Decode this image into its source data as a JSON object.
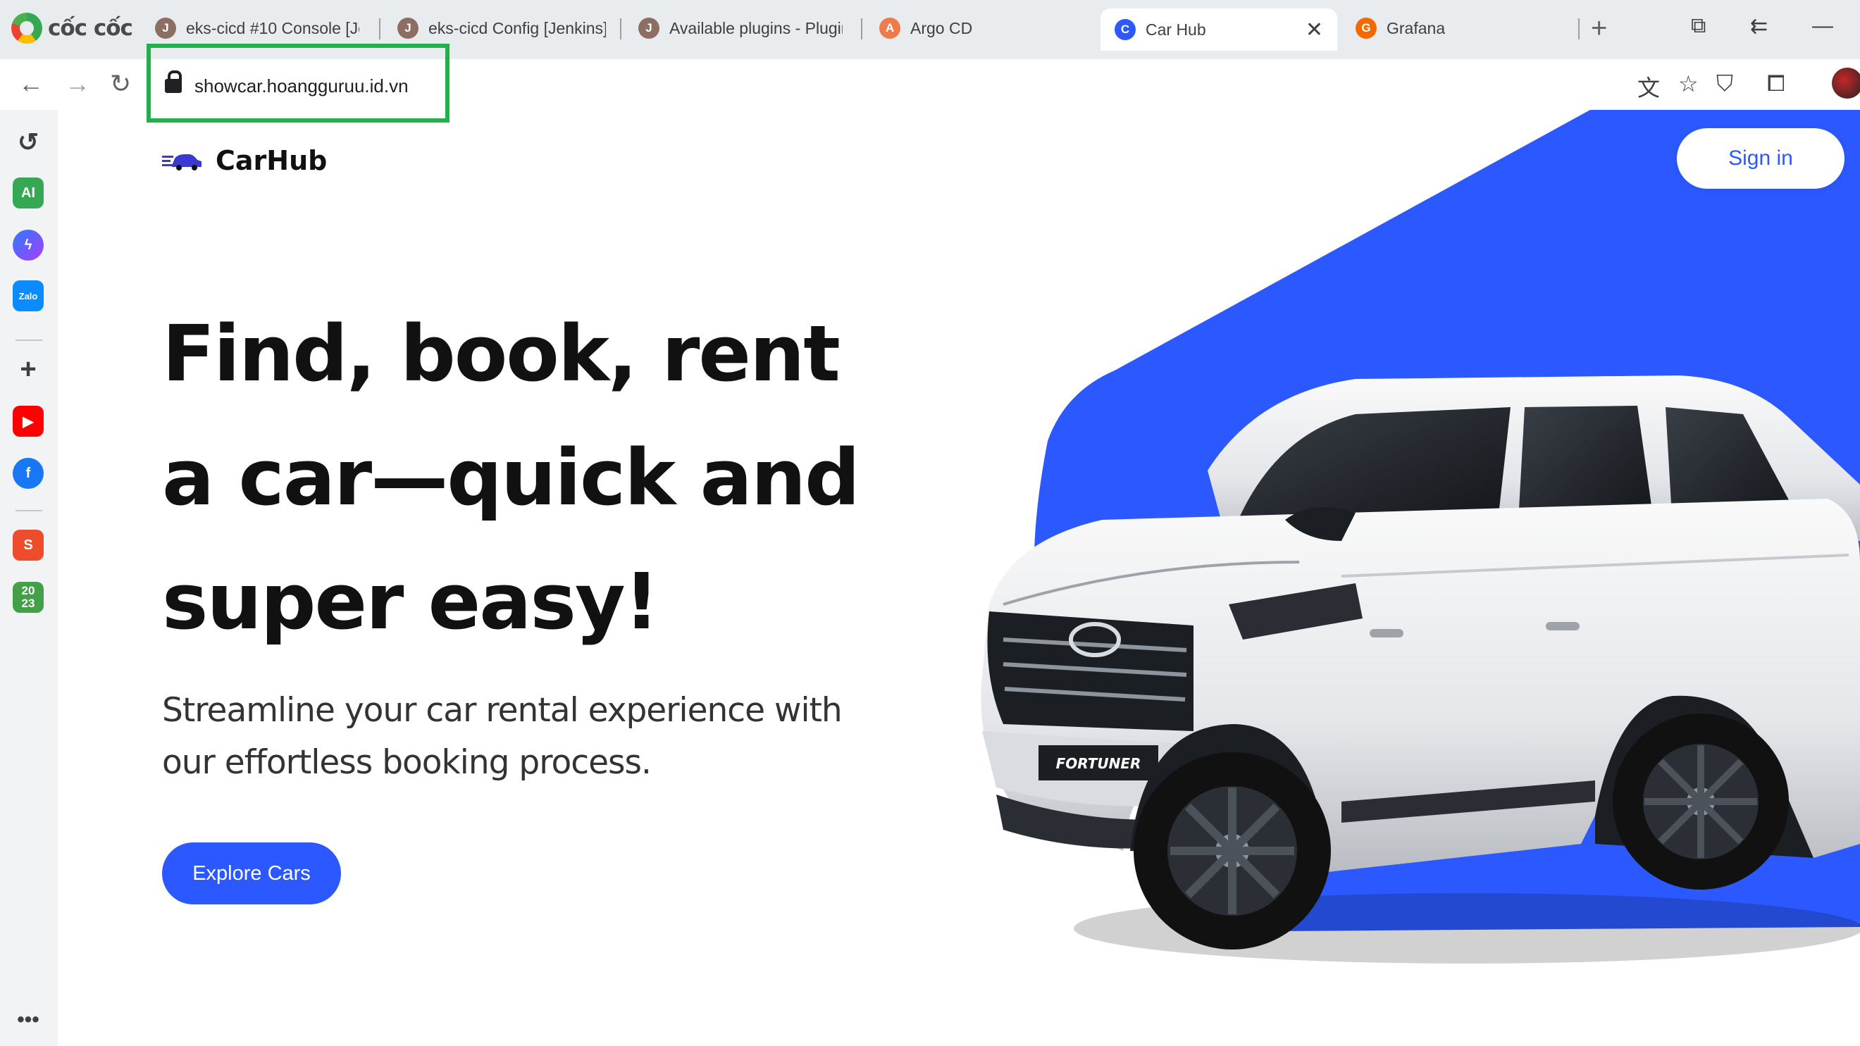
{
  "browser": {
    "brand": "cốc cốc",
    "tabs": [
      {
        "title": "eks-cicd #10 Console [Jer",
        "favicon": "jenkins-icon"
      },
      {
        "title": "eks-cicd Config [Jenkins]",
        "favicon": "jenkins-icon"
      },
      {
        "title": "Available plugins - Plugir",
        "favicon": "jenkins-icon"
      },
      {
        "title": "Argo CD",
        "favicon": "argo-icon"
      },
      {
        "title": "Car Hub",
        "favicon": "carhub-icon",
        "active": true
      },
      {
        "title": "Grafana",
        "favicon": "grafana-icon"
      }
    ],
    "url": "showcar.hoangguruu.id.vn"
  },
  "sidebar": {
    "items": [
      "history-icon",
      "ai-icon",
      "messenger-icon",
      "zalo-icon",
      "add-icon",
      "youtube-icon",
      "facebook-icon",
      "shopee-icon",
      "calendar-2023-icon"
    ],
    "ai_label": "AI",
    "zalo_label": "Zalo",
    "shopee_label": "S",
    "calendar_label_top": "20",
    "calendar_label_bottom": "23"
  },
  "page": {
    "brand": "CarHub",
    "sign_in": "Sign in",
    "hero_line1": "Find, book, rent",
    "hero_line2": "a car—quick and",
    "hero_line3": "super easy!",
    "subtitle_line1": "Streamline your car rental experience with",
    "subtitle_line2": "our effortless booking process.",
    "cta": "Explore Cars",
    "car_plate": "FORTUNER"
  },
  "colors": {
    "accent": "#2b59ff",
    "highlight": "#22b04a"
  }
}
